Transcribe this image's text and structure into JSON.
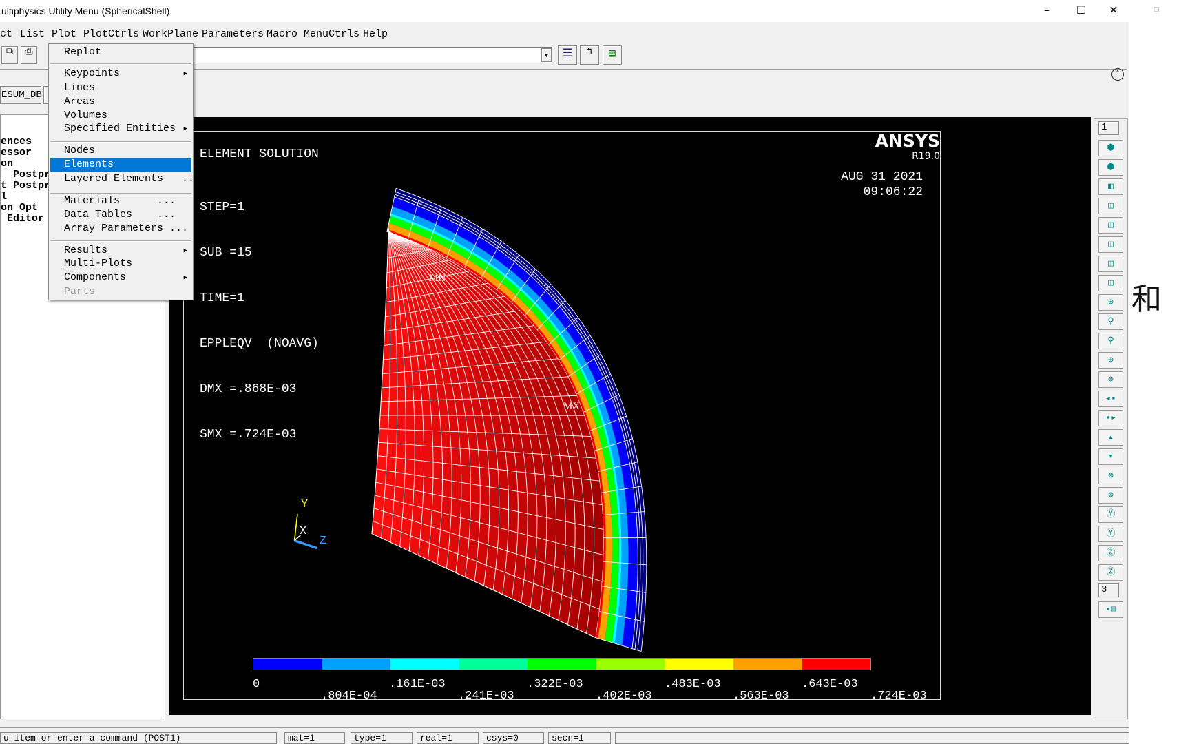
{
  "window": {
    "title": "ultiphysics Utility Menu (SphericalShell)",
    "min": "–",
    "max": "☐",
    "close": "✕"
  },
  "menubar": [
    "ct",
    "List",
    "Plot",
    "PlotCtrls",
    "WorkPlane",
    "Parameters",
    "Macro",
    "MenuCtrls",
    "Help"
  ],
  "toolbar": {
    "resum_label": "ESUM_DB",
    "command_value": ""
  },
  "tree": [
    "ences",
    "essor",
    "on",
    "  Postpro",
    "t Postpr",
    "l",
    "on Opt",
    " Editor"
  ],
  "plot_menu": {
    "items": [
      {
        "label": "Replot"
      },
      {
        "label": "Keypoints",
        "submenu": true
      },
      {
        "label": "Lines"
      },
      {
        "label": "Areas"
      },
      {
        "label": "Volumes"
      },
      {
        "label": "Specified Entities",
        "submenu": true
      },
      {
        "label": "Nodes"
      },
      {
        "label": "Elements",
        "selected": true
      },
      {
        "label": "Layered Elements   ..."
      },
      {
        "label": "Materials      ..."
      },
      {
        "label": "Data Tables    ..."
      },
      {
        "label": "Array Parameters ..."
      },
      {
        "label": "Results",
        "submenu": true
      },
      {
        "label": "Multi-Plots"
      },
      {
        "label": "Components",
        "submenu": true
      },
      {
        "label": "Parts",
        "disabled": true
      }
    ]
  },
  "plot": {
    "heading": "ELEMENT SOLUTION",
    "info": [
      "STEP=1",
      "SUB =15",
      "TIME=1",
      "EPPLEQV  (NOAVG)",
      "DMX =.868E-03",
      "SMX =.724E-03"
    ],
    "brand": "ANSYS",
    "version": "R19.0",
    "date": "AUG 31 2021",
    "time": "09:06:22",
    "min_label": "MN",
    "max_label": "MX",
    "triad": {
      "y": "Y",
      "x": "X",
      "z": "Z"
    },
    "legend_colors": [
      "#0000ff",
      "#00a0ff",
      "#00ffff",
      "#00ff9a",
      "#00ff00",
      "#9aff00",
      "#ffff00",
      "#ffa000",
      "#ff0000"
    ],
    "legend_labels_top": [
      "0",
      ".161E-03",
      ".322E-03",
      ".483E-03",
      ".643E-03"
    ],
    "legend_labels_bottom": [
      ".804E-04",
      ".241E-03",
      ".402E-03",
      ".563E-03",
      ".724E-03"
    ]
  },
  "right_toolbar": {
    "window_select": "1",
    "rotate_step": "3"
  },
  "status": [
    "u item or enter a command (POST1)",
    "mat=1",
    "type=1",
    "real=1",
    "csys=0",
    "secn=1"
  ],
  "background_text": "和"
}
